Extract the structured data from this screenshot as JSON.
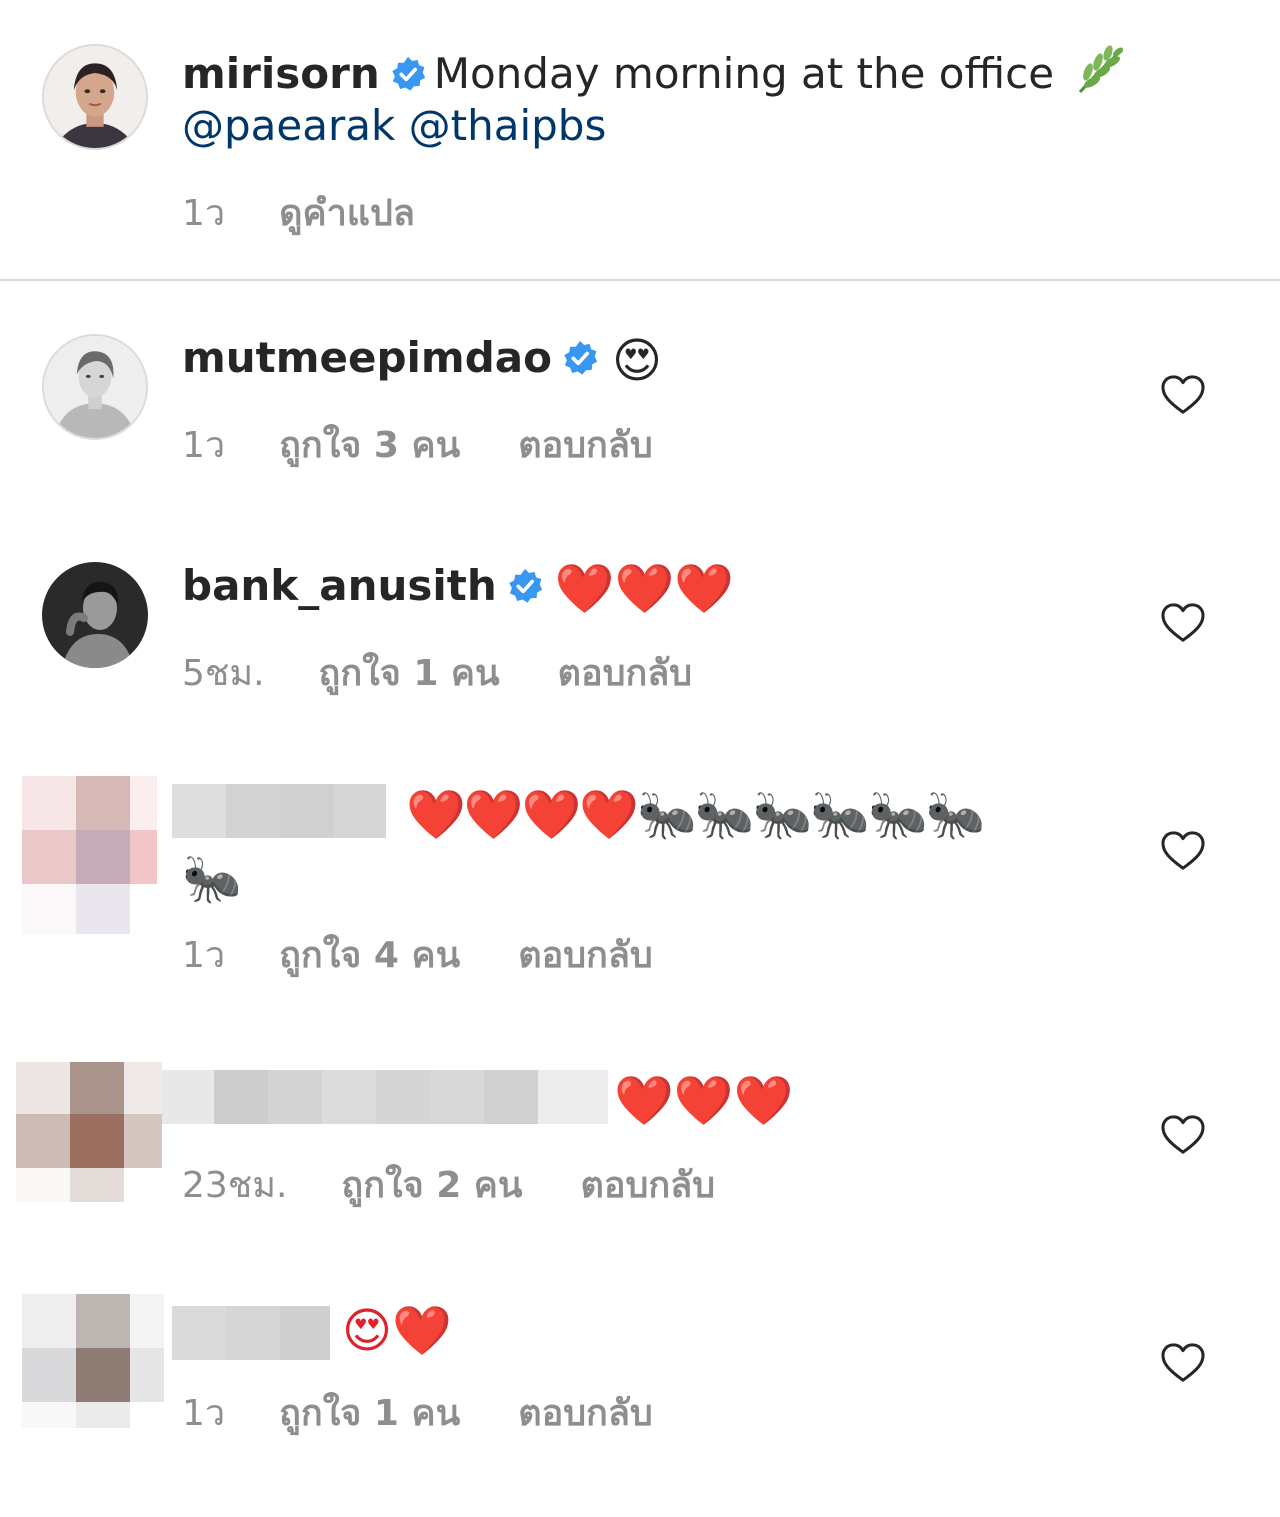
{
  "caption": {
    "username": "mirisorn",
    "text": "Monday morning at the office",
    "leaf_icon": "herb-icon",
    "mentions": "@paearak @thaipbs",
    "time": "1ว",
    "translate_label": "ดูคำแปล"
  },
  "comments": [
    {
      "username": "mutmeepimdao",
      "emoji": "😍",
      "time": "1ว",
      "likes": "ถูกใจ 3 คน",
      "reply_label": "ตอบกลับ"
    },
    {
      "username": "bank_anusith",
      "emoji": "❤️❤️❤️",
      "time": "5ชม.",
      "likes": "ถูกใจ 1 คน",
      "reply_label": "ตอบกลับ"
    },
    {
      "username": "",
      "emoji_line1": "❤️❤️❤️❤️🐜🐜🐜🐜🐜🐜",
      "emoji_line2": "🐜",
      "time": "1ว",
      "likes": "ถูกใจ 4 คน",
      "reply_label": "ตอบกลับ"
    },
    {
      "username": "",
      "emoji": "❤️❤️❤️",
      "time": "23ชม.",
      "likes": "ถูกใจ 2 คน",
      "reply_label": "ตอบกลับ"
    },
    {
      "username": "",
      "emoji": "😍❤️",
      "time": "1ว",
      "likes": "ถูกใจ 1 คน",
      "reply_label": "ตอบกลับ"
    }
  ],
  "colors": {
    "text": "#262626",
    "meta": "#8e8e8e",
    "mention": "#00376b",
    "verified": "#3897f0",
    "divider": "#dbdbdb"
  }
}
